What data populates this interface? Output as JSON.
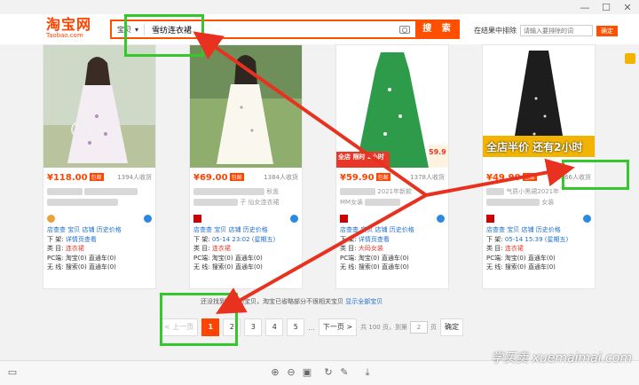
{
  "logo": {
    "main": "淘宝网",
    "sub": "Taobao.com"
  },
  "search": {
    "scope": "宝贝",
    "query": "雪纺连衣裙",
    "button": "搜 索"
  },
  "exclude": {
    "label": "在结果中排除",
    "placeholder": "请输入要排除的词",
    "button": "确定"
  },
  "products": [
    {
      "price": "¥118.00",
      "tag": "包邮",
      "sales": "1394人收货",
      "date": "",
      "category": "连衣裙"
    },
    {
      "price": "¥69.00",
      "tag": "包邮",
      "sales": "1384人收货",
      "date": "05-14 23:02 (星期五)",
      "category": "连衣裙",
      "title_frag": "秋盖",
      "title_frag2": "子 仙女连衣裙"
    },
    {
      "price": "¥59.90",
      "tag": "包邮",
      "sales": "1378人收货",
      "date": "",
      "category": "大码女装",
      "title_frag": "2021年新款",
      "title_frag2": "MM女装"
    },
    {
      "price": "¥49.90",
      "tag": "包邮",
      "sales": "1366人收货",
      "date": "05-14 15:39 (星期五)",
      "category": "连衣裙",
      "title_frag": "气质小黑裙2021年",
      "title_frag2": "女装"
    }
  ],
  "card_common": {
    "links": [
      "店查查",
      "宝贝",
      "店铺",
      "历史价格"
    ],
    "row_down": "下 架:",
    "down_val": "详情页查看",
    "row_cat": "类 目:",
    "row_pc": "PC端:",
    "pc_val": "淘宝(0)  直通车(0)",
    "row_mob": "无 线:",
    "mob_val": "搜索(0)  直通车(0)"
  },
  "ads": {
    "badge_left": "全店",
    "badge_right": "限时 2小时",
    "coupon": "券后价",
    "coupon_price": "59.9",
    "banner": "全店半价 还有2小时"
  },
  "pagination": {
    "note_prefix": "还没找到满意的宝贝，淘宝已省略部分不很相关宝贝",
    "note_link": "显示全部宝贝",
    "prev": "< 上一页",
    "pages": [
      "1",
      "2",
      "3",
      "4",
      "5",
      "..."
    ],
    "next": "下一页 >",
    "total": "共 100 页，到第",
    "goto": "2",
    "page_unit": "页",
    "confirm": "确定"
  },
  "watermark": "学买卖 xuemaimai.com",
  "colors": {
    "accent": "#ff5000",
    "highlight": "#35c82c",
    "arrow": "#e8311f",
    "link": "#1e6fcd"
  }
}
